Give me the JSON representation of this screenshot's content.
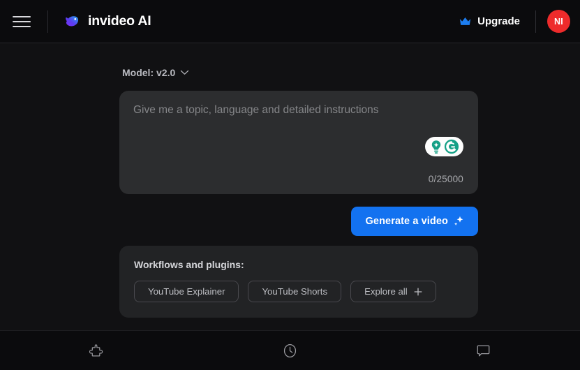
{
  "header": {
    "menu_icon": "hamburger-menu-icon",
    "logo_icon": "invideo-logo-icon",
    "brand_name": "invideo AI",
    "upgrade": {
      "icon": "crown-icon",
      "label": "Upgrade",
      "icon_color": "#1d7ef0"
    },
    "avatar": {
      "initials": "NI",
      "color": "#ee2b2b"
    }
  },
  "main": {
    "model_selector": {
      "label": "Model: v2.0",
      "icon": "chevron-down-icon"
    },
    "prompt": {
      "placeholder": "Give me a topic, language and detailed instructions",
      "value": "",
      "char_count": "0/25000"
    },
    "grammarly": {
      "bulb_icon": "lightbulb-icon",
      "logo_icon": "grammarly-g-icon",
      "accent": "#15a086"
    },
    "generate_button": {
      "label": "Generate a video",
      "icon": "sparkle-icon",
      "color": "#1372f0"
    },
    "workflows": {
      "title": "Workflows and plugins:",
      "chips": [
        {
          "label": "YouTube Explainer",
          "icon": null
        },
        {
          "label": "YouTube Shorts",
          "icon": null
        },
        {
          "label": "Explore all",
          "icon": "plus-icon"
        }
      ]
    }
  },
  "bottom_nav": {
    "items": [
      {
        "icon": "puzzle-piece-icon",
        "name": "plugins"
      },
      {
        "icon": "clock-icon",
        "name": "history"
      },
      {
        "icon": "chat-bubble-icon",
        "name": "chat"
      }
    ]
  }
}
